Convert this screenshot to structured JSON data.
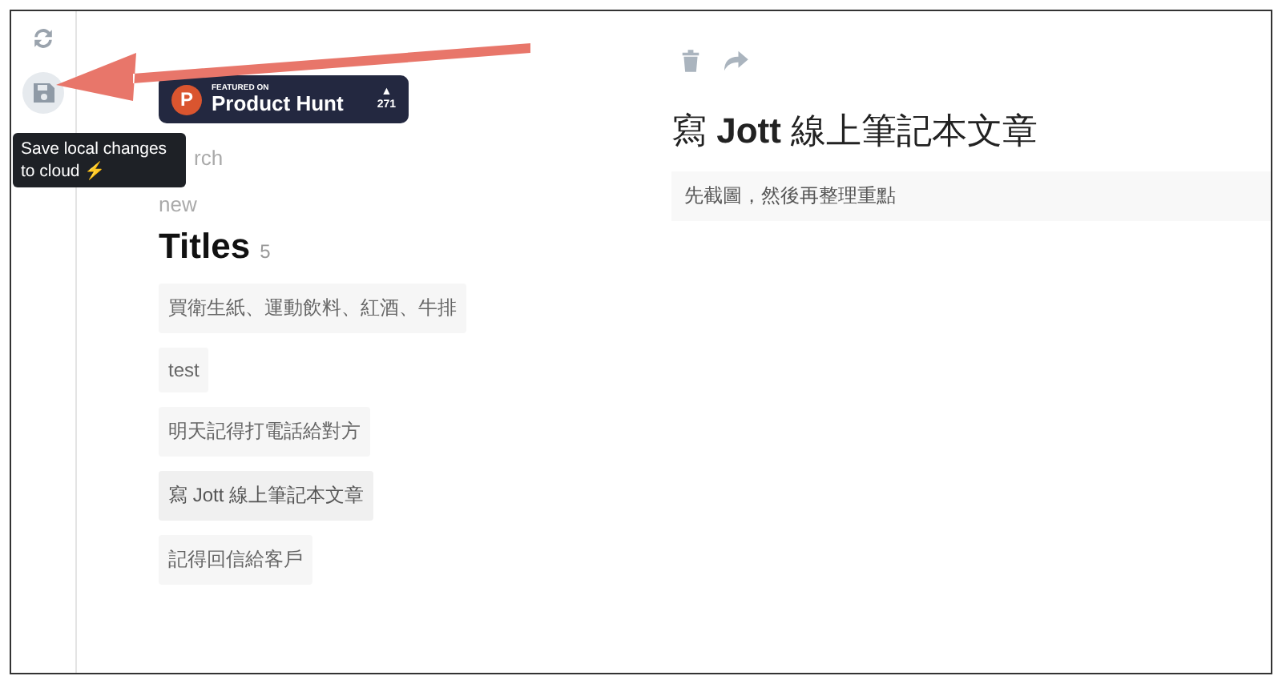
{
  "sidebar": {
    "tooltip": "Save local changes to cloud ⚡"
  },
  "badge": {
    "logo": "P",
    "featured": "FEATURED ON",
    "name": "Product Hunt",
    "arrow": "▲",
    "votes": "271"
  },
  "search": {
    "value": "rch"
  },
  "new_link": "new",
  "titles": {
    "heading": "Titles",
    "count": "5",
    "items": [
      {
        "text": "買衛生紙、運動飲料、紅酒、牛排",
        "selected": false
      },
      {
        "text": "test",
        "selected": false
      },
      {
        "text": "明天記得打電話給對方",
        "selected": false
      },
      {
        "text": "寫 Jott 線上筆記本文章",
        "selected": true
      },
      {
        "text": "記得回信給客戶",
        "selected": false
      }
    ]
  },
  "note": {
    "title": "寫 **Jott** 線上筆記本文章",
    "body": "先截圖，然後再整理重點"
  }
}
